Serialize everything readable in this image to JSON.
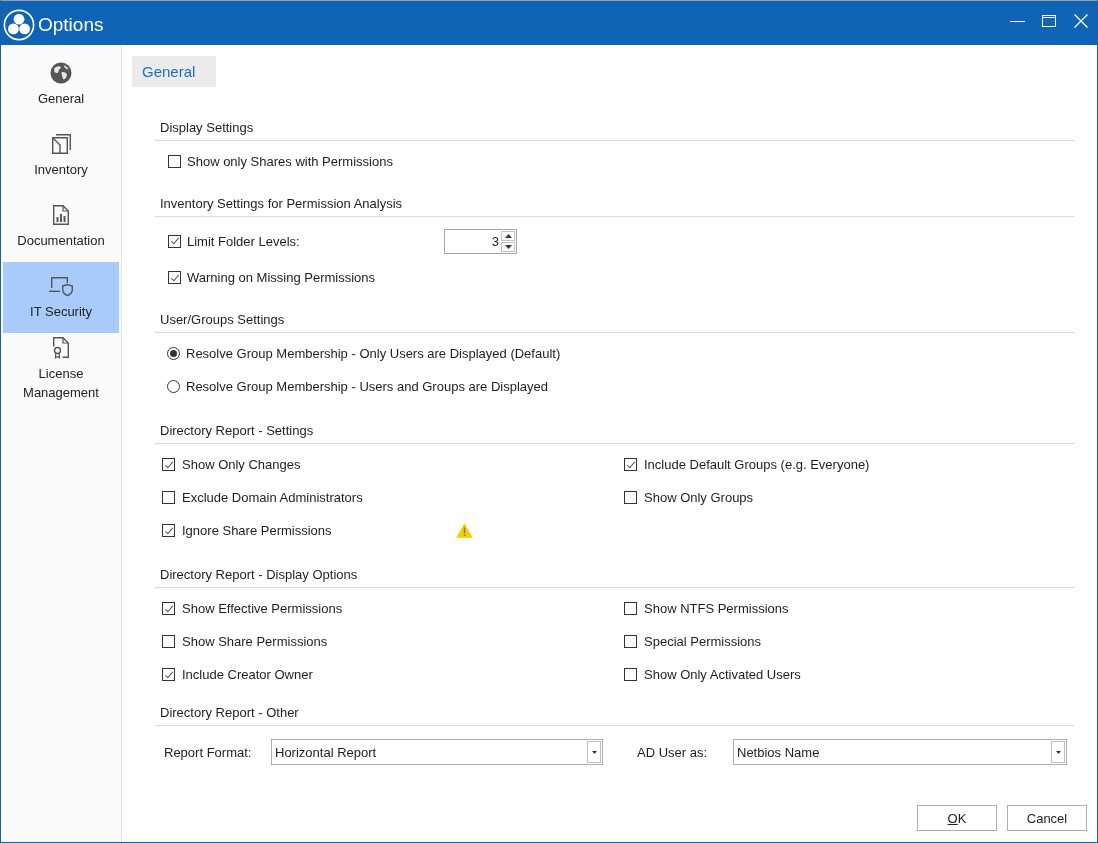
{
  "window": {
    "title": "Options"
  },
  "sidebar": {
    "items": [
      {
        "label": "General",
        "selected": false
      },
      {
        "label": "Inventory",
        "selected": false
      },
      {
        "label": "Documentation",
        "selected": false
      },
      {
        "label": "IT Security",
        "selected": true
      },
      {
        "label": "License Management",
        "selected": false
      }
    ]
  },
  "tabs": [
    {
      "label": "General",
      "selected": true
    }
  ],
  "sections": [
    {
      "title": "Display Settings",
      "kind": "list",
      "items": [
        {
          "kind": "checkbox",
          "label": "Show only Shares with Permissions",
          "checked": false
        }
      ]
    },
    {
      "title": "Inventory Settings for Permission Analysis",
      "kind": "list",
      "items": [
        {
          "kind": "spinner",
          "label": "Limit Folder Levels:",
          "checked": true,
          "value": "3"
        },
        {
          "kind": "checkbox",
          "label": "Warning on Missing Permissions",
          "checked": true
        }
      ]
    },
    {
      "title": "User/Groups Settings",
      "kind": "list",
      "items": [
        {
          "kind": "radio",
          "label": "Resolve Group Membership - Only Users are Displayed (Default)",
          "selected": true
        },
        {
          "kind": "radio",
          "label": "Resolve Group Membership - Users and Groups are Displayed",
          "selected": false
        }
      ]
    },
    {
      "title": "Directory Report - Settings",
      "kind": "columns",
      "columns": [
        {
          "items": [
            {
              "kind": "checkbox",
              "label": "Show Only Changes",
              "checked": true,
              "warning": false
            },
            {
              "kind": "checkbox",
              "label": "Exclude Domain Administrators",
              "checked": false,
              "warning": false
            },
            {
              "kind": "checkbox",
              "label": "Ignore Share Permissions",
              "checked": true,
              "warning": true
            }
          ]
        },
        {
          "items": [
            {
              "kind": "checkbox",
              "label": "Include Default Groups (e.g. Everyone)",
              "checked": true
            },
            {
              "kind": "checkbox",
              "label": "Show Only Groups",
              "checked": false
            }
          ]
        }
      ]
    },
    {
      "title": "Directory Report - Display Options",
      "kind": "columns",
      "columns": [
        {
          "items": [
            {
              "kind": "checkbox",
              "label": "Show Effective Permissions",
              "checked": true
            },
            {
              "kind": "checkbox",
              "label": "Show Share Permissions",
              "checked": false
            },
            {
              "kind": "checkbox",
              "label": "Include Creator Owner",
              "checked": true
            }
          ]
        },
        {
          "items": [
            {
              "kind": "checkbox",
              "label": "Show NTFS Permissions",
              "checked": false
            },
            {
              "kind": "checkbox",
              "label": "Special Permissions",
              "checked": false
            },
            {
              "kind": "checkbox",
              "label": "Show Only Activated Users",
              "checked": false
            }
          ]
        }
      ]
    },
    {
      "title": "Directory Report - Other",
      "kind": "fields",
      "fields": [
        {
          "label": "Report Format:",
          "value": "Horizontal Report"
        },
        {
          "label": "AD User as:",
          "value": "Netbios Name"
        }
      ]
    }
  ],
  "buttons": [
    {
      "label": "OK",
      "access_key": true
    },
    {
      "label": "Cancel",
      "access_key": false
    }
  ]
}
